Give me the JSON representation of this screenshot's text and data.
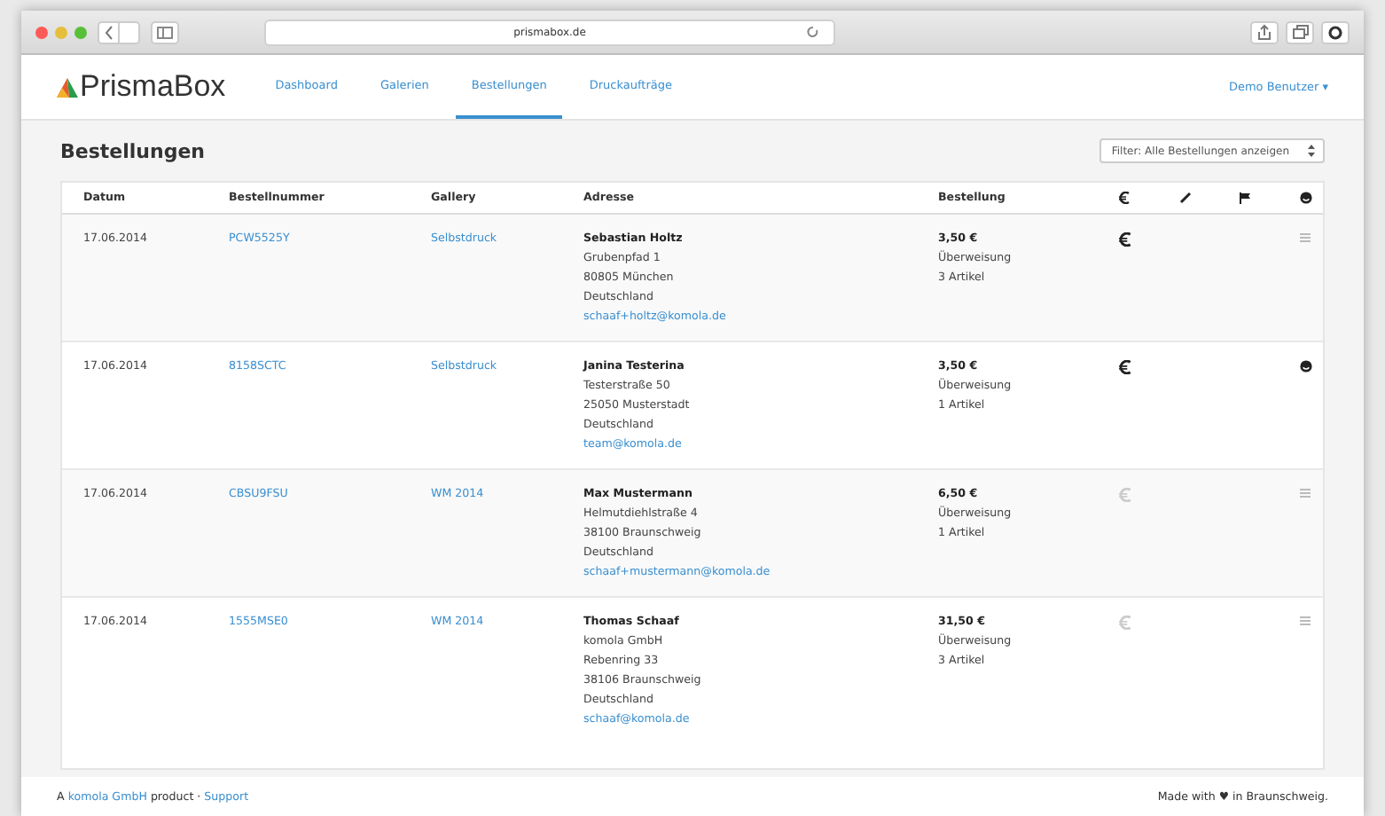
{
  "browser": {
    "url": "prismabox.de"
  },
  "nav": {
    "logo": "PrismaBox",
    "tabs": [
      {
        "label": "Dashboard",
        "selected": false
      },
      {
        "label": "Galerien",
        "selected": false
      },
      {
        "label": "Bestellungen",
        "selected": true
      },
      {
        "label": "Druckaufträge",
        "selected": false
      }
    ],
    "user": "Demo Benutzer ▾"
  },
  "page": {
    "title": "Bestellungen",
    "filter": "Filter: Alle Bestellungen anzeigen"
  },
  "table": {
    "columns": [
      "Datum",
      "Bestellnummer",
      "Gallery",
      "Adresse",
      "Bestellung"
    ],
    "rows": [
      {
        "date": "17.06.2014",
        "number": "PCW5525Y",
        "gallery": "Selbstdruck",
        "name": "Sebastian Holtz",
        "address": [
          "Grubenpfad 1",
          "80805 München",
          "Deutschland"
        ],
        "email": "schaaf+holtz@komola.de",
        "total": "3,50 €",
        "payment": "Überweisung",
        "items": "3 Artikel",
        "paid": true,
        "done": false
      },
      {
        "date": "17.06.2014",
        "number": "8158SCTC",
        "gallery": "Selbstdruck",
        "name": "Janina Testerina",
        "address": [
          "Testerstraße 50",
          "25050 Musterstadt",
          "Deutschland"
        ],
        "email": "team@komola.de",
        "total": "3,50 €",
        "payment": "Überweisung",
        "items": "1 Artikel",
        "paid": true,
        "done": true
      },
      {
        "date": "17.06.2014",
        "number": "CBSU9FSU",
        "gallery": "WM 2014",
        "name": "Max Mustermann",
        "address": [
          "Helmutdiehlstraße 4",
          "38100 Braunschweig",
          "Deutschland"
        ],
        "email": "schaaf+mustermann@komola.de",
        "total": "6,50 €",
        "payment": "Überweisung",
        "items": "1 Artikel",
        "paid": false,
        "done": false
      },
      {
        "date": "17.06.2014",
        "number": "1555MSE0",
        "gallery": "WM 2014",
        "name": "Thomas Schaaf",
        "address": [
          "komola GmbH",
          "Rebenring 33",
          "38106 Braunschweig",
          "Deutschland"
        ],
        "email": "schaaf@komola.de",
        "total": "31,50 €",
        "payment": "Überweisung",
        "items": "3 Artikel",
        "paid": false,
        "done": false
      }
    ]
  },
  "footer": {
    "prefix": "A",
    "company": "komola GmbH",
    "middle": "product ·",
    "support": "Support",
    "right": "Made with ♥ in Braunschweig."
  }
}
